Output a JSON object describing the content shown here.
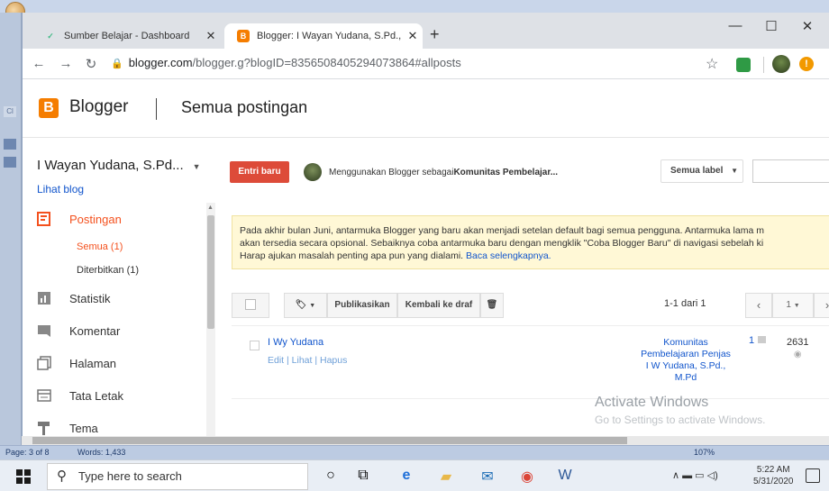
{
  "browser": {
    "tabs": [
      {
        "title": "Sumber Belajar - Dashboard"
      },
      {
        "title": "Blogger: I Wayan Yudana, S.Pd., M"
      }
    ],
    "url_host": "blogger.com",
    "url_path": "/blogger.g?blogID=8356508405294073864#allposts"
  },
  "blogger": {
    "brand": "Blogger",
    "page_title": "Semua postingan",
    "blog_name": "I Wayan Yudana, S.Pd...",
    "view_blog": "Lihat blog",
    "new_post": "Entri baru",
    "using_as_prefix": "Menggunakan Blogger sebagai ",
    "using_as_name": "Komunitas Pembelajar...",
    "label_select": "Semua label",
    "nav": [
      {
        "label": "Postingan",
        "icon": "posts-icon"
      },
      {
        "label": "Statistik",
        "icon": "stats-icon"
      },
      {
        "label": "Komentar",
        "icon": "comment-icon"
      },
      {
        "label": "Halaman",
        "icon": "pages-icon"
      },
      {
        "label": "Tata Letak",
        "icon": "layout-icon"
      },
      {
        "label": "Tema",
        "icon": "theme-icon"
      }
    ],
    "sub_nav": [
      {
        "label": "Semua (1)"
      },
      {
        "label": "Diterbitkan (1)"
      }
    ],
    "notice": {
      "line1": "Pada akhir bulan Juni, antarmuka Blogger yang baru akan menjadi setelan default bagi semua pengguna. Antarmuka lama m",
      "line2": "akan tersedia secara opsional. Sebaiknya coba antarmuka baru dengan mengklik \"Coba Blogger Baru\" di navigasi sebelah ki",
      "line3": "Harap ajukan masalah penting apa pun yang dialami. ",
      "link": "Baca selengkapnya."
    },
    "toolbar": {
      "publish": "Publikasikan",
      "revert": "Kembali ke draf",
      "range": "1-1 dari 1",
      "per_page": "1"
    },
    "posts": [
      {
        "title": "I Wy Yudana",
        "actions": "Edit | Lihat | Hapus",
        "author": "Komunitas Pembelajaran Penjas I W Yudana, S.Pd., M.Pd",
        "comments": "1",
        "views": "2631"
      }
    ]
  },
  "watermark": {
    "line1": "Activate Windows",
    "line2": "Go to Settings to activate Windows."
  },
  "word_status": {
    "page": "Page: 3 of 8",
    "words": "Words: 1,433",
    "zoom": "107%"
  },
  "taskbar": {
    "search_placeholder": "Type here to search",
    "time": "5:22 AM",
    "date": "5/31/2020"
  }
}
